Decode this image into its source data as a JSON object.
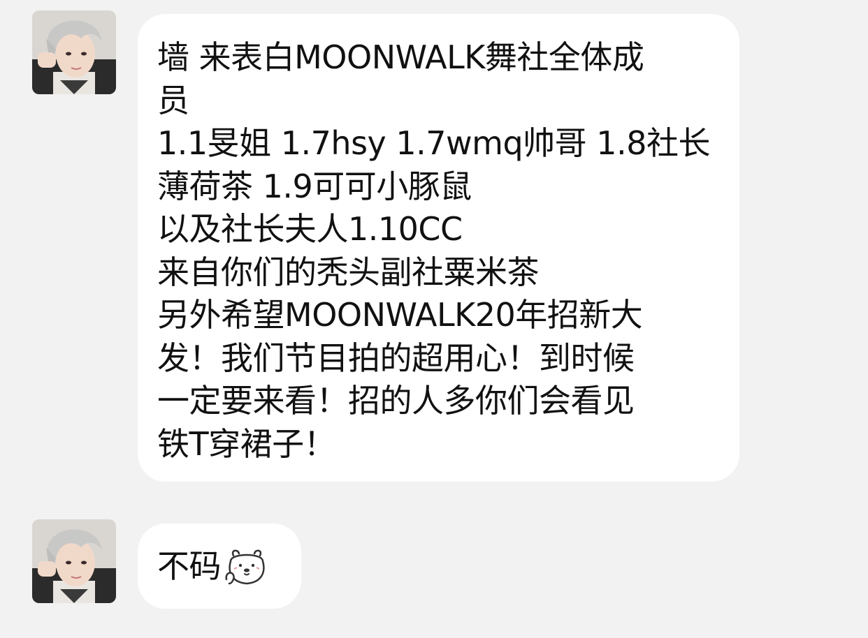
{
  "messages": [
    {
      "lines": [
        "墙 来表白MOONWALK舞社全体成",
        "员",
        "1.1旻姐 1.7hsy 1.7wmq帅哥 1.8社长",
        "薄荷茶 1.9可可小豚鼠",
        "以及社长夫人1.10CC",
        "来自你们的秃头副社粟米茶",
        "另外希望MOONWALK20年招新大",
        "发！我们节目拍的超用心！到时候",
        "一定要来看！招的人多你们会看见",
        "铁T穿裙子！"
      ]
    },
    {
      "text": "不码",
      "emoji": "polar-bear-shy-icon"
    }
  ],
  "colors": {
    "background": "#f2f2f2",
    "bubble": "#ffffff",
    "text": "#111111"
  }
}
